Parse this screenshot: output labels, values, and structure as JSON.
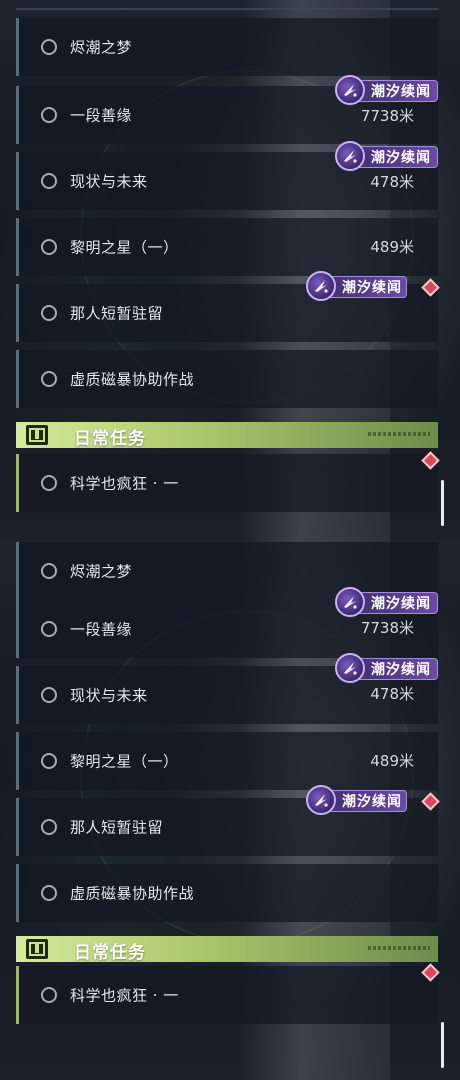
{
  "colors": {
    "accent_green": "#a9c56a",
    "badge_purple": "#6b4ba5",
    "diamond_red": "#e0445a"
  },
  "quests": [
    {
      "title": "烬潮之梦",
      "distance": "",
      "badge": "",
      "marker": false
    },
    {
      "title": "一段善缘",
      "distance": "7738米",
      "badge": "潮汐续闻",
      "marker": false
    },
    {
      "title": "现状与未来",
      "distance": "478米",
      "badge": "潮汐续闻",
      "marker": false
    },
    {
      "title": "黎明之星（一）",
      "distance": "489米",
      "badge": "",
      "marker": false
    },
    {
      "title": "那人短暂驻留",
      "distance": "",
      "badge": "潮汐续闻",
      "marker": true
    },
    {
      "title": "虚质磁暴协助作战",
      "distance": "",
      "badge": "",
      "marker": false
    }
  ],
  "daily_section": {
    "title": "日常任务",
    "icon": "exclamation-icon",
    "quests": [
      {
        "title": "科学也疯狂 · 一",
        "marker": true
      }
    ]
  },
  "badge_icon": "sparkle-feather-icon",
  "marker_icon": "tracking-diamond-icon"
}
